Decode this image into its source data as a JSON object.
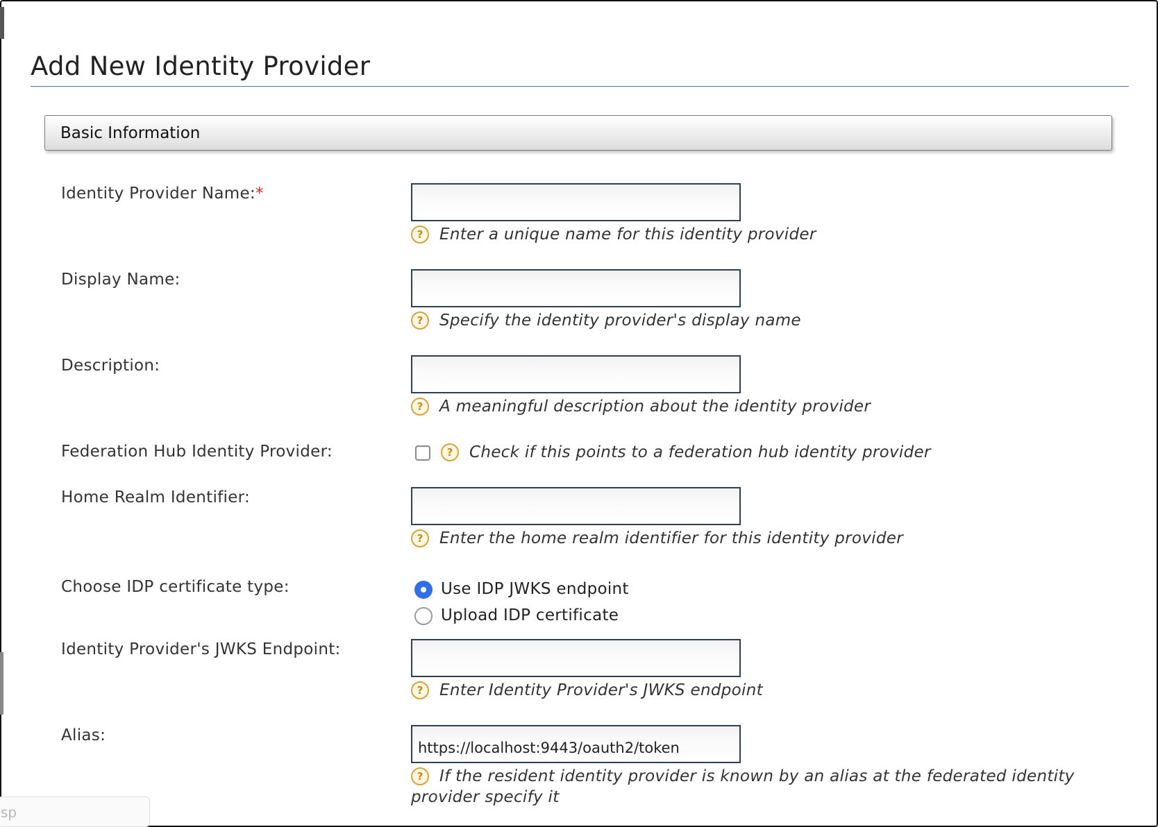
{
  "page": {
    "title": "Add New Identity Provider"
  },
  "section": {
    "title": "Basic Information"
  },
  "fields": {
    "idp_name": {
      "label": "Identity Provider Name:",
      "required_mark": "*",
      "value": "",
      "help": "Enter a unique name for this identity provider"
    },
    "display_name": {
      "label": "Display Name:",
      "value": "",
      "help": "Specify the identity provider's display name"
    },
    "description": {
      "label": "Description:",
      "value": "",
      "help": "A meaningful description about the identity provider"
    },
    "federation_hub": {
      "label": "Federation Hub Identity Provider:",
      "checked": false,
      "help": "Check if this points to a federation hub identity provider"
    },
    "home_realm": {
      "label": "Home Realm Identifier:",
      "value": "",
      "help": "Enter the home realm identifier for this identity provider"
    },
    "cert_type": {
      "label": "Choose IDP certificate type:",
      "options": [
        {
          "label": "Use IDP JWKS endpoint",
          "selected": true
        },
        {
          "label": "Upload IDP certificate",
          "selected": false
        }
      ]
    },
    "jwks_endpoint": {
      "label": "Identity Provider's JWKS Endpoint:",
      "value": "",
      "help": "Enter Identity Provider's JWKS endpoint"
    },
    "alias": {
      "label": "Alias:",
      "value": "https://localhost:9443/oauth2/token",
      "help_line1": "If the resident identity provider is known by an alias at the federated identity",
      "help_line2": "provider specify it"
    }
  },
  "help_icon_glyph": "?",
  "search": {
    "text": "sp"
  },
  "colors": {
    "accent": "#2f6fea",
    "help_icon": "#d9a33a",
    "required": "#dd2222",
    "title_rule": "#4a6fa5"
  }
}
